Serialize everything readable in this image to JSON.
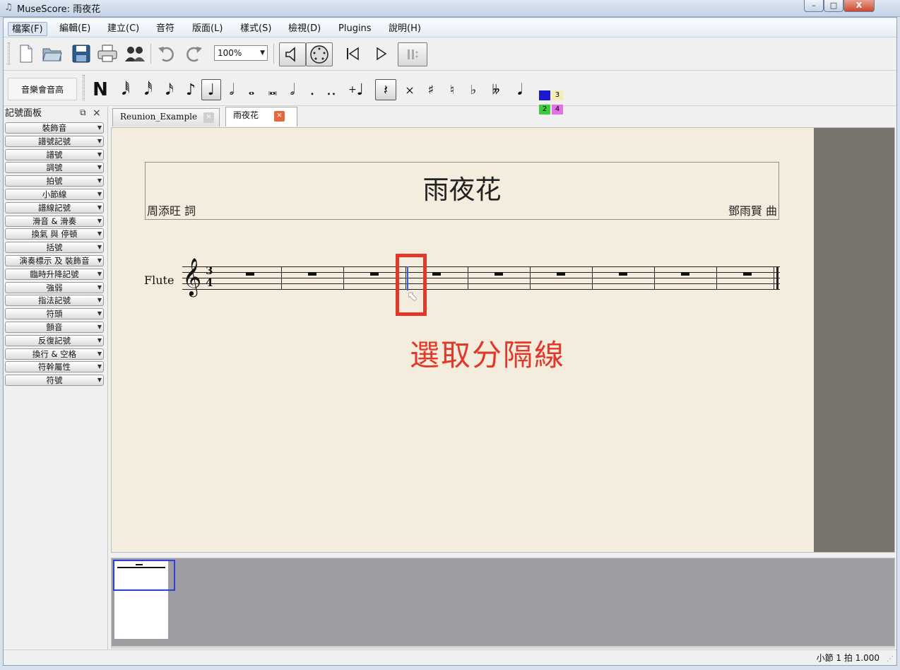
{
  "window": {
    "title": "MuseScore: 雨夜花",
    "app_icon": "musescore-icon",
    "minimize_glyph": "–",
    "maximize_glyph": "□",
    "close_glyph": "X"
  },
  "menubar": {
    "items": [
      "檔案(F)",
      "編輯(E)",
      "建立(C)",
      "音符",
      "版面(L)",
      "樣式(S)",
      "檢視(D)",
      "Plugins",
      "說明(H)"
    ]
  },
  "toolbar": {
    "zoom_value": "100%",
    "icons": [
      "new-file-icon",
      "open-file-icon",
      "save-icon",
      "print-icon",
      "parts-icon",
      "undo-icon",
      "redo-icon",
      "speaker-icon",
      "midi-input-icon",
      "rewind-icon",
      "play-icon",
      "repeat-icon"
    ]
  },
  "note_toolbar": {
    "note_input_label": "音樂會音高",
    "note_input_mode": "N",
    "durations": [
      "𝅘𝅥𝅱",
      "𝅘𝅥𝅰",
      "𝅘𝅥𝅯",
      "♪",
      "♩",
      "𝅗𝅥",
      "𝅝",
      "𝅜",
      "𝅗𝅥",
      ".",
      "..",
      "♩"
    ],
    "rest_glyph": "𝄽",
    "accidentals": [
      "×",
      "♯",
      "♮",
      "♭",
      "𝄫"
    ],
    "flip_glyph": "𝅘𝅥",
    "voices": [
      "1",
      "2",
      "3",
      "4"
    ],
    "voice_colors": {
      "v1": "#1a1acc",
      "v2": "#3ecc3e",
      "v3": "#f5ecb4",
      "v4": "#e86ee8"
    }
  },
  "palette": {
    "title": "記號面板",
    "float_glyph": "⧉",
    "close_glyph": "×",
    "items": [
      "裝飾音",
      "譜號記號",
      "譜號",
      "調號",
      "拍號",
      "小節線",
      "譜線記號",
      "滑音 & 滑奏",
      "換氣 與 停頓",
      "括號",
      "演奏標示 及 裝飾音",
      "臨時升降記號",
      "強弱",
      "指法記號",
      "符頭",
      "顫音",
      "反復記號",
      "換行 & 空格",
      "符幹屬性",
      "符號"
    ]
  },
  "tabs": [
    {
      "label": "Reunion_Example",
      "close_glyph": "×"
    },
    {
      "label": "雨夜花",
      "close_glyph": "×"
    }
  ],
  "score": {
    "title": "雨夜花",
    "lyricist": "周添旺 詞",
    "composer": "鄧雨賢 曲",
    "instrument": "Flute",
    "clef": "𝄞",
    "time_sig_top": "3",
    "time_sig_bottom": "4",
    "measure_count": 9,
    "selected_barline_after_measure": 3,
    "annotation": "選取分隔線",
    "cursor_glyph": "⬉",
    "colors": {
      "annotation": "#e2382a",
      "selection": "#3a5ae0",
      "paper": "#f4ecdc"
    }
  },
  "status": {
    "text": "小節 1 拍 1.000"
  }
}
